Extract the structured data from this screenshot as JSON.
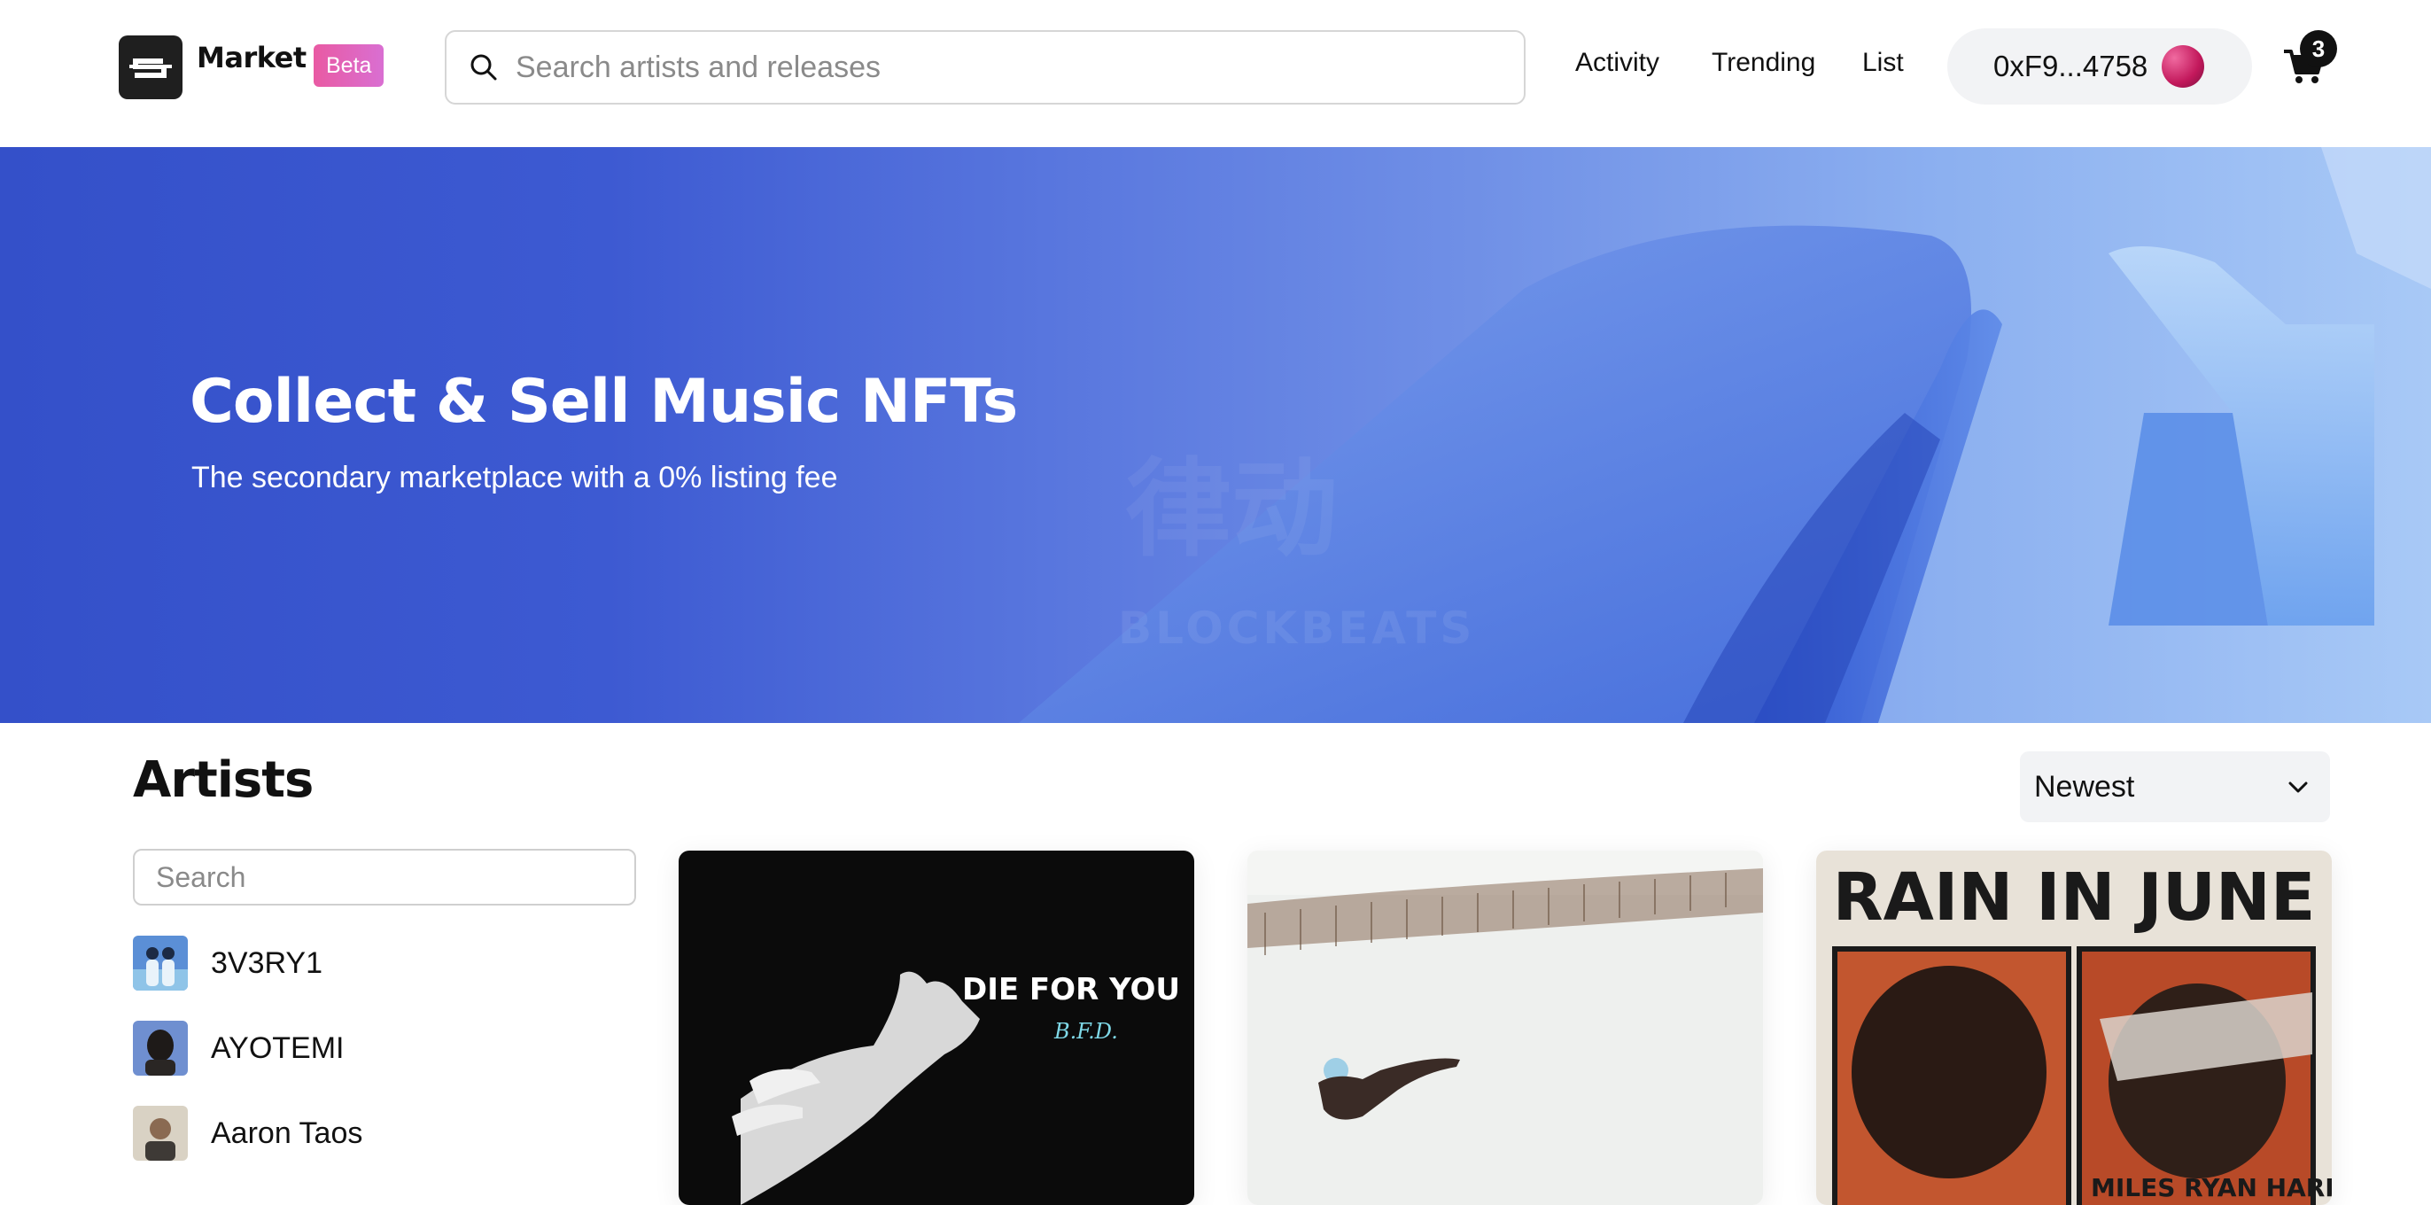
{
  "header": {
    "brand": "Market",
    "badge": "Beta",
    "search_placeholder": "Search artists and releases",
    "nav": [
      "Activity",
      "Trending",
      "List"
    ],
    "wallet_address": "0xF9...4758",
    "cart_count": "3"
  },
  "hero": {
    "title": "Collect & Sell Music NFTs",
    "subtitle": "The secondary marketplace with a 0% listing fee",
    "watermark_text": [
      "律动",
      "BLOCKBEATS"
    ]
  },
  "artists": {
    "title": "Artists",
    "sort_selected": "Newest",
    "search_placeholder": "Search",
    "list": [
      "3V3RY1",
      "AYOTEMI",
      "Aaron Taos"
    ]
  },
  "releases": [
    {
      "art_text": "DIE FOR YOU",
      "art_subtext": "B.F.D."
    },
    {
      "art_text": ""
    },
    {
      "art_text": "RAIN IN JUNE",
      "art_subtext": "MILES RYAN HARRIS"
    }
  ],
  "colors": {
    "accent_badge": "#e95aa3",
    "hero": "#3450c9"
  }
}
